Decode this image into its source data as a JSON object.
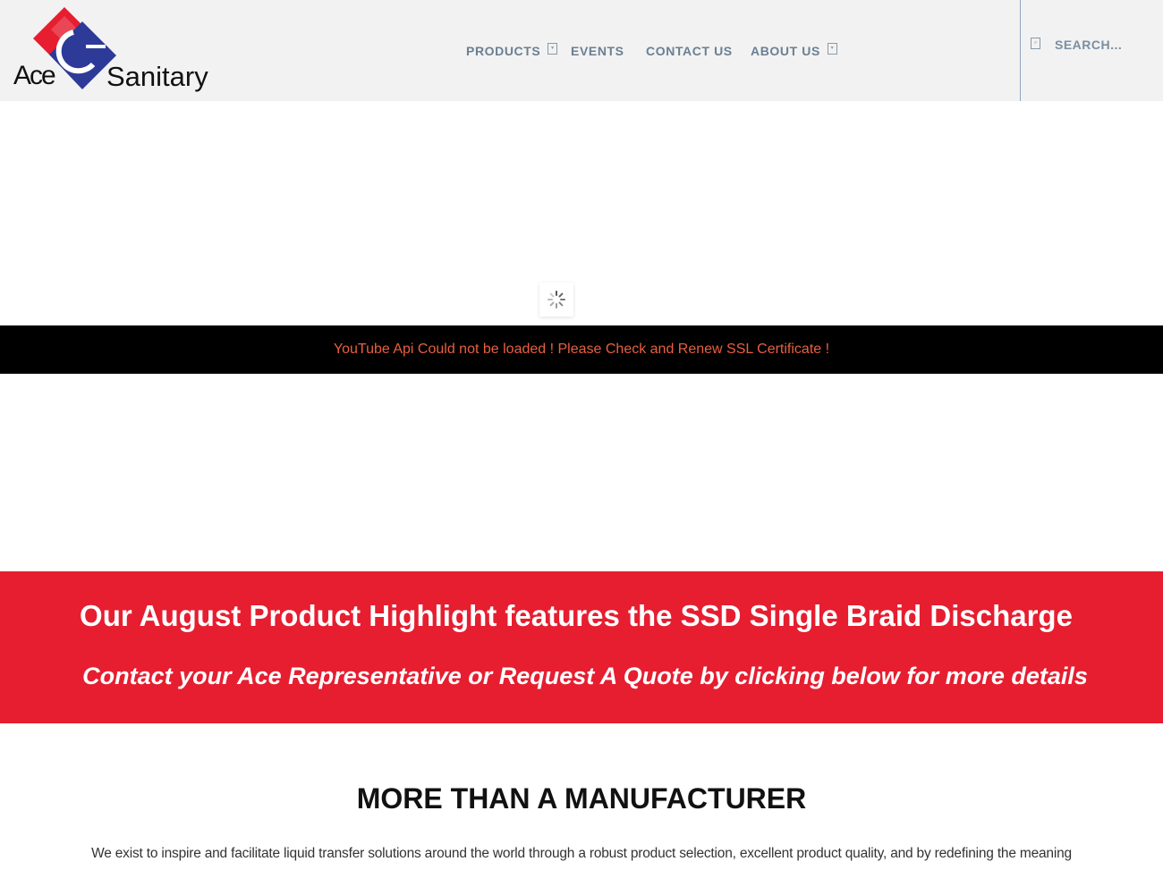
{
  "brand": {
    "logo_word_1": "Ace",
    "logo_word_2": "Sanitary",
    "colors": {
      "red": "#e61e30",
      "blue": "#2e3a97"
    }
  },
  "nav": {
    "items": [
      {
        "label": "PRODUCTS",
        "has_dropdown": true,
        "icon": "chevron-down-icon"
      },
      {
        "label": "EVENTS",
        "has_dropdown": false
      },
      {
        "label": "CONTACT US",
        "has_dropdown": false
      },
      {
        "label": "ABOUT US",
        "has_dropdown": true,
        "icon": "chevron-down-icon"
      }
    ]
  },
  "search": {
    "icon": "search-icon",
    "placeholder": "SEARCH..."
  },
  "video": {
    "loader_icon": "spinner-icon",
    "error_message": "YouTube Api Could not be loaded ! Please Check and Renew SSL Certificate !",
    "error_color": "#e8603f"
  },
  "banner": {
    "title": "Our August Product Highlight features the SSD Single Braid Discharge",
    "subtitle": "Contact your Ace Representative or Request A Quote by clicking below for more details",
    "background": "#e61e30"
  },
  "intro": {
    "title": "MORE THAN A MANUFACTURER",
    "text": "We exist to inspire and facilitate liquid transfer solutions around the world through a robust product selection, excellent product quality, and by redefining the meaning"
  }
}
